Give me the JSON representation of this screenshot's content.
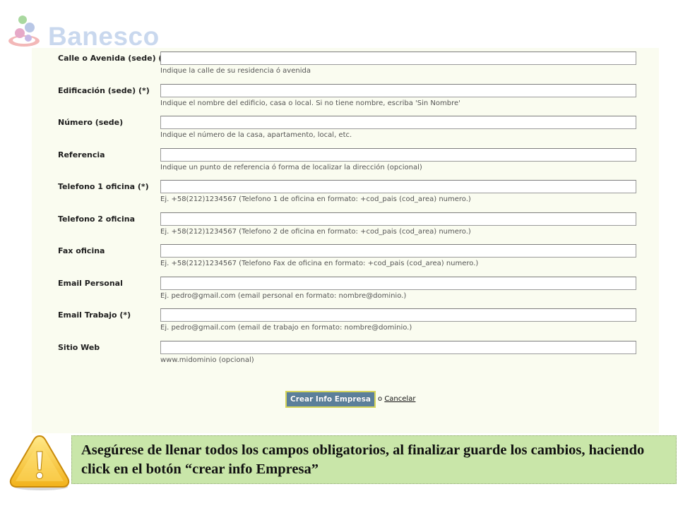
{
  "brand": {
    "name": "Banesco",
    "text_color": "#c9d8ee",
    "icon": "banesco-logo-icon"
  },
  "form": {
    "fields": [
      {
        "label": "Calle o Avenida (sede) (*)",
        "value": "",
        "hint": "Indique la calle de su residencia ó avenida"
      },
      {
        "label": "Edificación (sede) (*)",
        "value": "",
        "hint": "Indique el nombre del edificio, casa o local. Si no tiene nombre, escriba 'Sin Nombre'"
      },
      {
        "label": "Número (sede)",
        "value": "",
        "hint": "Indique el número de la casa, apartamento, local, etc."
      },
      {
        "label": "Referencia",
        "value": "",
        "hint": "Indique un punto de referencia ó forma de localizar la dirección (opcional)"
      },
      {
        "label": "Telefono 1 oficina (*)",
        "value": "",
        "hint": "Ej. +58(212)1234567 (Telefono 1 de oficina en formato: +cod_pais (cod_area) numero.)"
      },
      {
        "label": "Telefono 2 oficina",
        "value": "",
        "hint": "Ej. +58(212)1234567 (Telefono 2 de oficina en formato: +cod_pais (cod_area) numero.)"
      },
      {
        "label": "Fax oficina",
        "value": "",
        "hint": "Ej. +58(212)1234567 (Telefono Fax de oficina en formato: +cod_pais (cod_area) numero.)"
      },
      {
        "label": "Email Personal",
        "value": "",
        "hint": "Ej. pedro@gmail.com (email personal en formato: nombre@dominio.)"
      },
      {
        "label": "Email Trabajo (*)",
        "value": "",
        "hint": "Ej. pedro@gmail.com (email de trabajo en formato: nombre@dominio.)"
      },
      {
        "label": "Sitio Web",
        "value": "",
        "hint": "www.midominio (opcional)"
      }
    ],
    "submit_label": "Crear Info Empresa",
    "cancel_prefix": "o",
    "cancel_label": "Cancelar",
    "panel_color": "#fafcf0",
    "button_color": "#5b7f9a",
    "button_border_color": "#d5d45a"
  },
  "warning": {
    "icon": "warning-triangle-icon",
    "text": "Asegúrese de llenar todos los campos obligatorios, al finalizar guarde los cambios, haciendo click en el botón “crear info Empresa”",
    "background_color": "#c9e6a9"
  }
}
